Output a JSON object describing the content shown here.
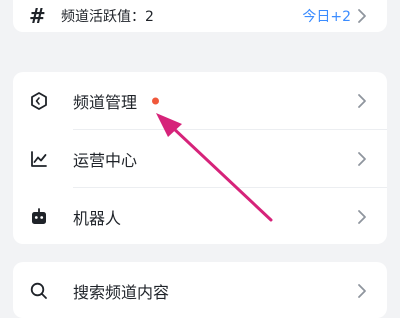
{
  "top_card": {
    "hash_icon": "hash-icon",
    "label": "频道活跃值：2",
    "today": "今日+2"
  },
  "menu": {
    "items": [
      {
        "icon": "shield-hexagon-icon",
        "label": "频道管理",
        "has_badge": true
      },
      {
        "icon": "trend-chart-icon",
        "label": "运营中心"
      },
      {
        "icon": "robot-icon",
        "label": "机器人"
      }
    ]
  },
  "search": {
    "icon": "search-icon",
    "label": "搜索频道内容"
  },
  "colors": {
    "accent": "#3b8cff",
    "badge": "#f0583b",
    "annotation_arrow": "#d6237a",
    "background": "#f2f3f5"
  }
}
